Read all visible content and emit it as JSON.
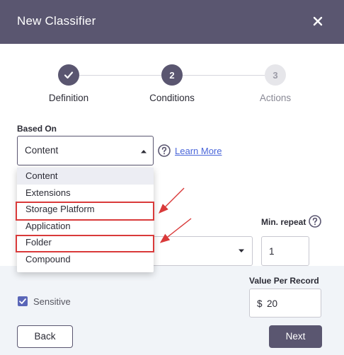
{
  "header": {
    "title": "New Classifier",
    "close_icon": "close-icon"
  },
  "stepper": {
    "steps": [
      {
        "number": "",
        "label": "Definition",
        "state": "completed",
        "icon": "check-icon"
      },
      {
        "number": "2",
        "label": "Conditions",
        "state": "active"
      },
      {
        "number": "3",
        "label": "Actions",
        "state": "pending"
      }
    ]
  },
  "based_on": {
    "label": "Based On",
    "value": "Content",
    "help_icon": "help-icon",
    "learn_more": "Learn More",
    "options": [
      "Content",
      "Extensions",
      "Storage Platform",
      "Application",
      "Folder",
      "Compound"
    ],
    "highlighted_options": [
      "Storage Platform",
      "Folder"
    ]
  },
  "min_repeat": {
    "label": "Min. repeat",
    "value": "1",
    "help_icon": "help-icon"
  },
  "sensitive": {
    "label": "Sensitive",
    "checked": true
  },
  "value_per_record": {
    "label": "Value Per Record",
    "currency": "$",
    "value": "20"
  },
  "footer": {
    "back_label": "Back",
    "next_label": "Next"
  },
  "colors": {
    "primary": "#5a5670",
    "link": "#4a66d9",
    "highlight": "#d93a3a",
    "checkbox": "#5a66b8"
  }
}
